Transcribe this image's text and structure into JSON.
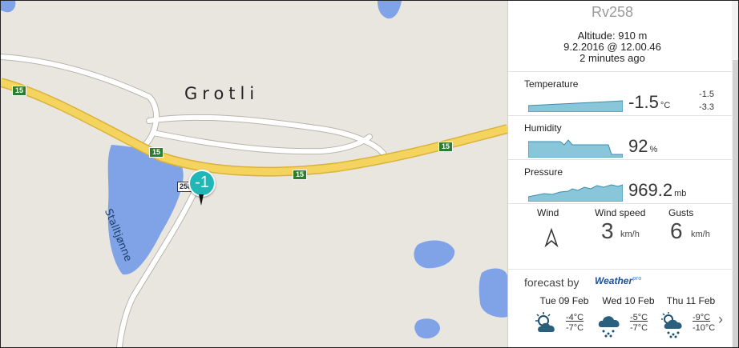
{
  "map": {
    "place_name": "Grotli",
    "lake_name": "Stalltjønne",
    "road_number": "15",
    "local_road": "258",
    "marker_value": "-1",
    "colors": {
      "land": "#e9e6df",
      "water": "#7fa3e6",
      "road": "#f4d35e",
      "minor_road": "#ffffff"
    }
  },
  "station": {
    "name": "Rv258",
    "altitude": "Altitude: 910 m",
    "timestamp": "9.2.2016 @ 12.00.46",
    "age": "2 minutes ago"
  },
  "metrics": {
    "temperature": {
      "label": "Temperature",
      "value": "-1.5",
      "unit": "°C",
      "max": "-1.5",
      "min": "-3.3"
    },
    "humidity": {
      "label": "Humidity",
      "value": "92",
      "unit": "%"
    },
    "pressure": {
      "label": "Pressure",
      "value": "969.2",
      "unit": "mb"
    }
  },
  "wind": {
    "wind_label": "Wind",
    "speed_label": "Wind speed",
    "gusts_label": "Gusts",
    "speed_value": "3",
    "gust_value": "6",
    "unit": "km/h",
    "direction_icon": "wind-arrow-icon"
  },
  "forecast": {
    "label": "forecast by",
    "provider": "Weather",
    "provider_suffix": "pro",
    "days": [
      {
        "name": "Tue 09 Feb",
        "high": "-4°C",
        "low": "-7°C",
        "icon": "partly-cloudy-icon"
      },
      {
        "name": "Wed 10 Feb",
        "high": "-5°C",
        "low": "-7°C",
        "icon": "snow-cloud-icon"
      },
      {
        "name": "Thu 11 Feb",
        "high": "-9°C",
        "low": "-10°C",
        "icon": "sun-snow-cloud-icon"
      }
    ],
    "next_icon": "chevron-right-icon"
  }
}
